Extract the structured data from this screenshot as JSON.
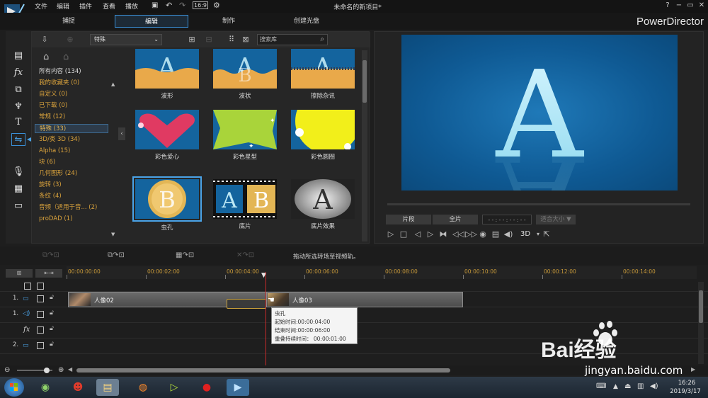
{
  "window": {
    "title": "未命名的新项目*",
    "brand": "PowerDirector",
    "menu": [
      "文件",
      "编辑",
      "插件",
      "查看",
      "播放"
    ],
    "controls": [
      "?",
      "−",
      "▭",
      "✕"
    ]
  },
  "tabs": [
    {
      "label": "捕捉",
      "active": false
    },
    {
      "label": "编辑",
      "active": true
    },
    {
      "label": "制作",
      "active": false
    },
    {
      "label": "创建光盘",
      "active": false
    }
  ],
  "library": {
    "category_select": "特殊",
    "search_placeholder": "搜索库",
    "categories": [
      {
        "label": "所有内容 (134)",
        "style": "white"
      },
      {
        "label": "我的收藏夹 (0)",
        "style": "orange"
      },
      {
        "label": "自定义 (0)",
        "style": "orange"
      },
      {
        "label": "已下载 (0)",
        "style": "orange"
      },
      {
        "label": "常规 (12)",
        "style": "orange"
      },
      {
        "label": "特殊 (33)",
        "style": "selected"
      },
      {
        "label": "3D/类 3D (34)",
        "style": "orange"
      },
      {
        "label": "Alpha (15)",
        "style": "orange"
      },
      {
        "label": "块 (6)",
        "style": "orange"
      },
      {
        "label": "几何图形 (24)",
        "style": "orange"
      },
      {
        "label": "旋转 (3)",
        "style": "orange"
      },
      {
        "label": "条纹 (4)",
        "style": "orange"
      },
      {
        "label": "音频（适用于音... (2)",
        "style": "orange"
      },
      {
        "label": "proDAD (1)",
        "style": "orange"
      }
    ],
    "thumbnails": [
      {
        "label": "波形",
        "kind": "wave"
      },
      {
        "label": "波状",
        "kind": "wavy"
      },
      {
        "label": "擦除杂讯",
        "kind": "noise"
      },
      {
        "label": "彩色爱心",
        "kind": "heart"
      },
      {
        "label": "彩色星型",
        "kind": "star"
      },
      {
        "label": "彩色圆圈",
        "kind": "circle"
      },
      {
        "label": "虫孔",
        "kind": "wormhole",
        "selected": true
      },
      {
        "label": "底片",
        "kind": "film"
      },
      {
        "label": "底片效果",
        "kind": "negative"
      }
    ]
  },
  "preview": {
    "letter": "A",
    "buttons": {
      "clip": "片段",
      "movie": "全片",
      "timecode": "- - : - - : - - : - -",
      "fit": "适合大小 ▼",
      "mode3d": "3D"
    }
  },
  "timeline": {
    "hint": "拖动所选转场至视频轨。",
    "ruler": [
      "00:00:00:00",
      "00:00:02:00",
      "00:00:04:00",
      "00:00:06:00",
      "00:00:08:00",
      "00:00:10:00",
      "00:00:12:00",
      "00:00:14:00"
    ],
    "tracks": [
      {
        "num": "1.",
        "type": "video"
      },
      {
        "num": "1.",
        "type": "audio"
      },
      {
        "num": "",
        "type": "fx",
        "icon": "fx"
      },
      {
        "num": "2.",
        "type": "video"
      }
    ],
    "clips": [
      {
        "label": "人像02"
      },
      {
        "label": "人像03"
      }
    ],
    "tooltip": {
      "title": "虫孔",
      "start": "起始时间:00:00:04:00",
      "end": "结束时间:00:00:06:00",
      "overlap": "重叠持续时间： 00:00:01:00"
    }
  },
  "taskbar": {
    "time": "16:26",
    "date": "2019/3/17"
  },
  "watermark": {
    "logo_text": "Bai经验",
    "url": "jingyan.baidu.com"
  }
}
